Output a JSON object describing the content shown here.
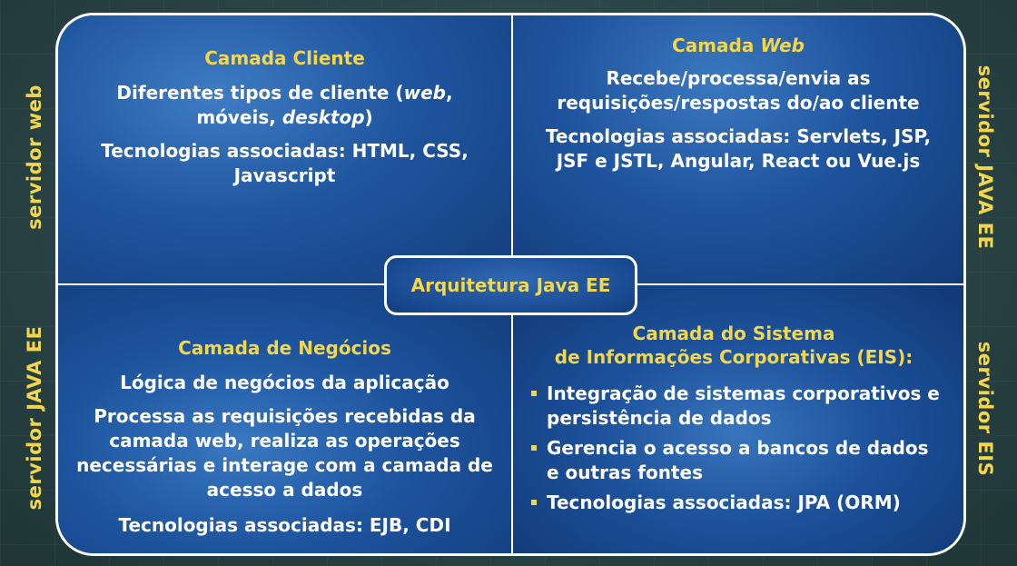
{
  "side_labels": {
    "left_top": "servidor web",
    "left_bottom": "servidor JAVA EE",
    "right_top": "servidor JAVA EE",
    "right_bottom": "servidor EIS"
  },
  "center": {
    "label": "Arquitetura Java EE"
  },
  "client_layer": {
    "title": "Camada Cliente",
    "desc_prefix": "Diferentes tipos de cliente (",
    "desc_web": "web",
    "desc_middle": ", móveis, ",
    "desc_desktop": "desktop",
    "desc_suffix": ")",
    "tech": "Tecnologias associadas: HTML, CSS, Javascript"
  },
  "web_layer": {
    "title_prefix": "Camada ",
    "title_italic": "Web",
    "desc": "Recebe/processa/envia as requisições/respostas do/ao cliente",
    "tech": "Tecnologias associadas: Servlets, JSP, JSF e JSTL, Angular, React ou Vue.js"
  },
  "business_layer": {
    "title": "Camada de Negócios",
    "desc1": "Lógica de negócios da aplicação",
    "desc2": "Processa as requisições recebidas da camada web, realiza as operações necessárias e interage com a camada de acesso a dados",
    "tech": "Tecnologias associadas: EJB, CDI"
  },
  "eis_layer": {
    "title_line1": "Camada do Sistema",
    "title_line2": "de Informações Corporativas (EIS):",
    "bullets": [
      "Integração de sistemas corporativos e persistência de dados",
      "Gerencia o acesso a bancos de dados e outras fontes",
      "Tecnologias associadas: JPA (ORM)"
    ]
  },
  "colors": {
    "accent": "#f2d64b",
    "panel": "#1f56a0",
    "background": "#2a4446"
  }
}
